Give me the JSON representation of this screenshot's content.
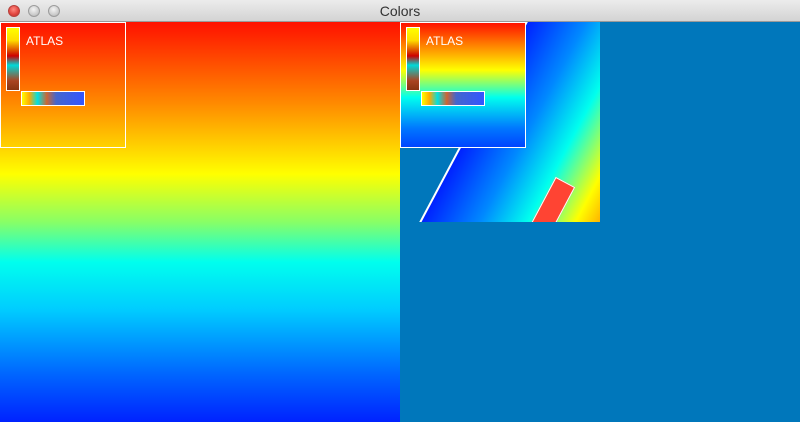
{
  "window": {
    "title": "Colors",
    "background_color": "#0077bb"
  },
  "titlebar": {
    "buttons": [
      {
        "name": "close",
        "color": "#e0443e"
      },
      {
        "name": "minimize",
        "color": "#c9c9c9"
      },
      {
        "name": "zoom",
        "color": "#c9c9c9"
      }
    ]
  },
  "canvas": {
    "gradient_colors": [
      "#ff1100",
      "#ff8800",
      "#ffff00",
      "#00ffee",
      "#00ccff",
      "#0022ff"
    ],
    "inset_left": {
      "label": "ATLAS"
    },
    "inset_right": {
      "label": "ATLAS"
    },
    "highlight_rect_color": "#ff4433"
  }
}
